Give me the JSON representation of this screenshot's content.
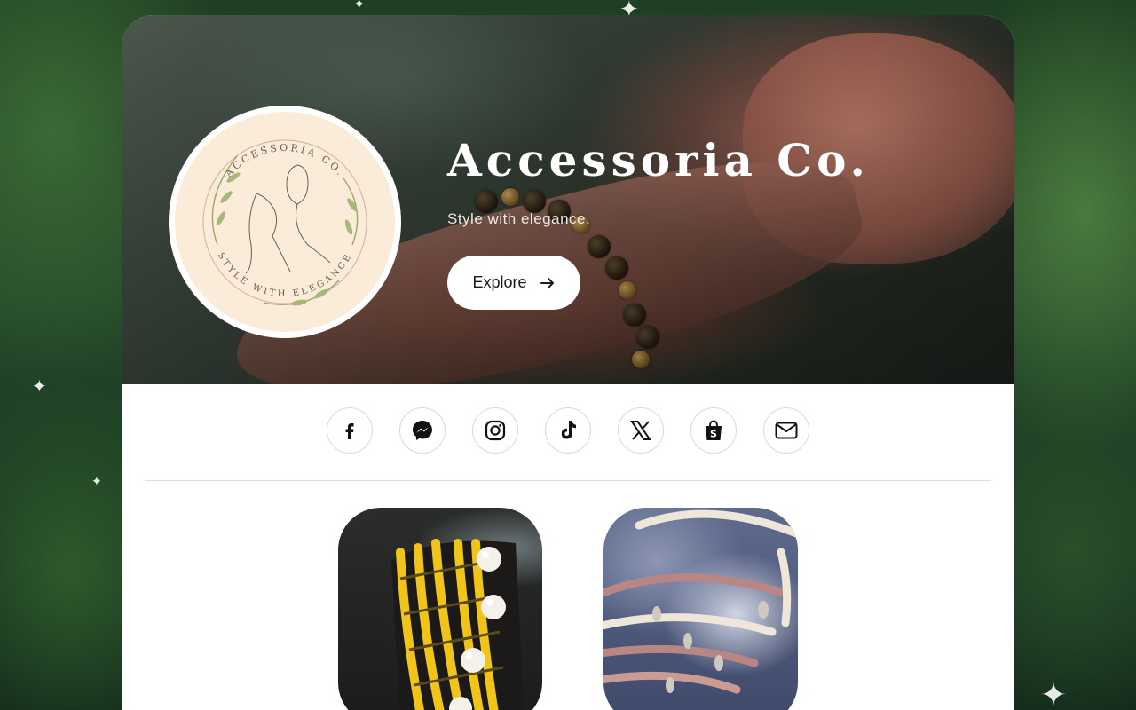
{
  "brand": {
    "name": "Accessoria Co.",
    "tagline": "Style with elegance.",
    "logo_text_top": "ACCESSORIA CO.",
    "logo_text_bottom": "STYLE WITH ELEGANCE"
  },
  "hero": {
    "explore_label": "Explore"
  },
  "socials": [
    {
      "name": "facebook-icon",
      "label": "Facebook"
    },
    {
      "name": "messenger-icon",
      "label": "Messenger"
    },
    {
      "name": "instagram-icon",
      "label": "Instagram"
    },
    {
      "name": "tiktok-icon",
      "label": "TikTok"
    },
    {
      "name": "x-icon",
      "label": "X"
    },
    {
      "name": "shopee-icon",
      "label": "Shopee"
    },
    {
      "name": "email-icon",
      "label": "Email"
    }
  ],
  "colors": {
    "background": "#1f3f22",
    "card": "#ffffff",
    "logo_bg": "#fbecd9",
    "button_bg": "#ffffff",
    "title_text": "#ffffff"
  },
  "gallery": [
    {
      "name": "yellow-macrame-bracelet-image"
    },
    {
      "name": "beaded-charm-bracelet-image"
    }
  ]
}
